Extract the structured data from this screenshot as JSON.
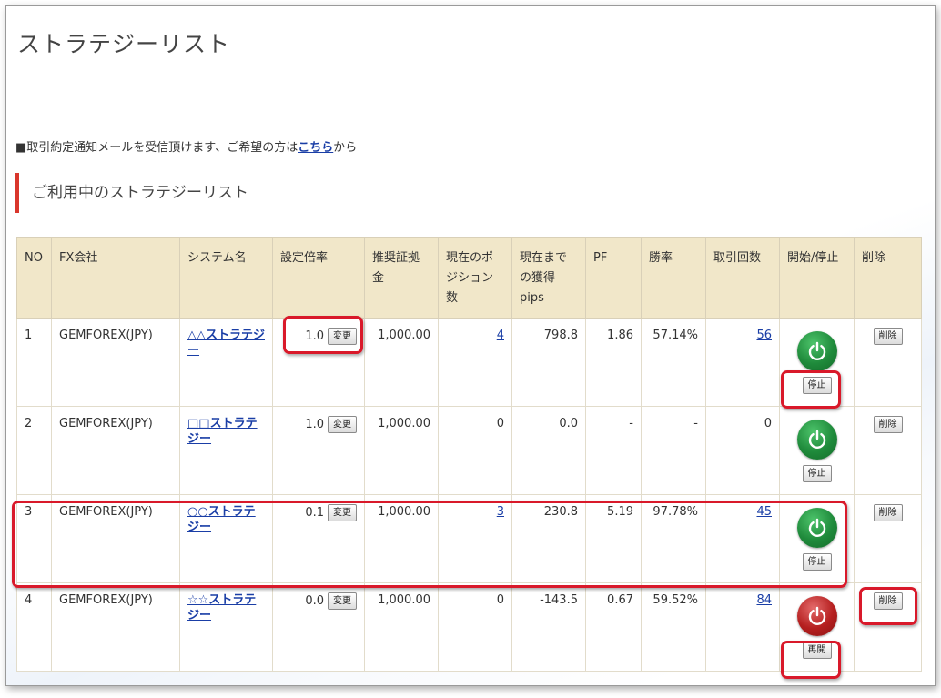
{
  "page_title": "ストラテジーリスト",
  "notice": {
    "prefix": "■取引約定通知メールを受信頂けます、ご希望の方は",
    "link": "こちら",
    "suffix": "から"
  },
  "section_title": "ご利用中のストラテジーリスト",
  "table": {
    "headers": [
      "NO",
      "FX会社",
      "システム名",
      "設定倍率",
      "推奨証拠金",
      "現在のポジション数",
      "現在までの獲得pips",
      "PF",
      "勝率",
      "取引回数",
      "開始/停止",
      "削除"
    ],
    "change_label": "変更",
    "delete_label": "削除",
    "rows": [
      {
        "no": "1",
        "company": "GEMFOREX(JPY)",
        "system": "△△ストラテジー",
        "multiplier": "1.0",
        "margin": "1,000.00",
        "positions": "4",
        "pips": "798.8",
        "pf": "1.86",
        "win_rate": "57.14%",
        "trades": "56",
        "status": "on",
        "toggle_label": "停止"
      },
      {
        "no": "2",
        "company": "GEMFOREX(JPY)",
        "system": "□□ストラテジー",
        "multiplier": "1.0",
        "margin": "1,000.00",
        "positions": "0",
        "pips": "0.0",
        "pf": "-",
        "win_rate": "-",
        "trades": "0",
        "status": "on",
        "toggle_label": "停止"
      },
      {
        "no": "3",
        "company": "GEMFOREX(JPY)",
        "system": "○○ストラテジー",
        "multiplier": "0.1",
        "margin": "1,000.00",
        "positions": "3",
        "pips": "230.8",
        "pf": "5.19",
        "win_rate": "97.78%",
        "trades": "45",
        "status": "on",
        "toggle_label": "停止"
      },
      {
        "no": "4",
        "company": "GEMFOREX(JPY)",
        "system": "☆☆ストラテジー",
        "multiplier": "0.0",
        "margin": "1,000.00",
        "positions": "0",
        "pips": "-143.5",
        "pf": "0.67",
        "win_rate": "59.52%",
        "trades": "84",
        "status": "off",
        "toggle_label": "再開"
      }
    ]
  },
  "colors": {
    "header_bg": "#f1e7c9",
    "highlight": "#d9192a",
    "power_on": "#1f8a3b",
    "power_off": "#b51f1f",
    "link": "#1a3ea6"
  }
}
